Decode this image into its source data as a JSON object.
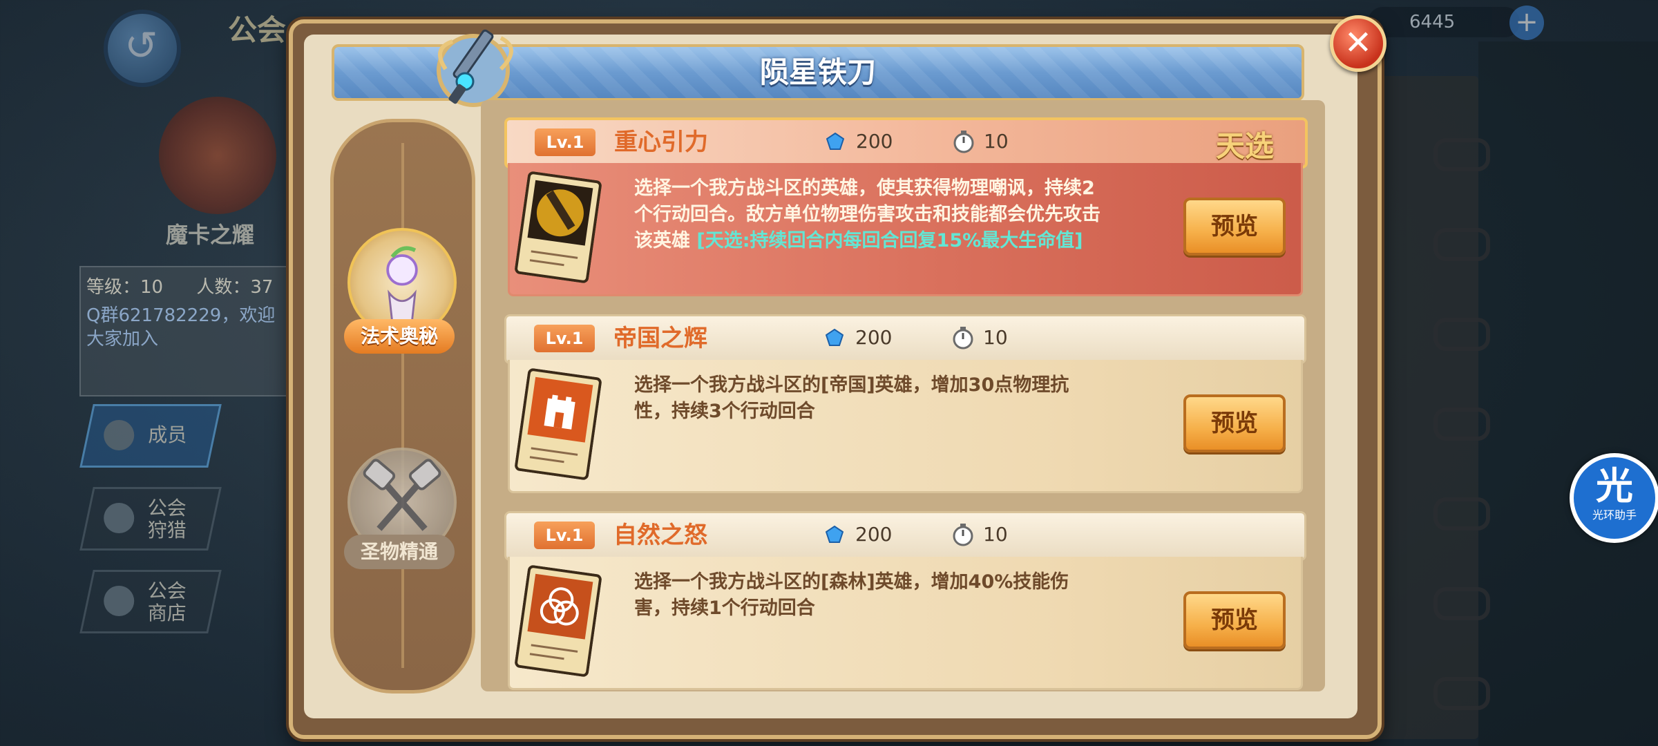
{
  "background": {
    "header_title": "公会",
    "guild_name": "魔卡之耀",
    "level_label": "等级：10",
    "members_label": "人数：37",
    "notice": "Q群621782229，欢迎大家加入",
    "currency_1": "6445",
    "nav": [
      {
        "label": "成员"
      },
      {
        "label": "公会\n狩猎"
      },
      {
        "label": "公会\n商店"
      }
    ]
  },
  "dialog": {
    "title": "陨星铁刀",
    "close_glyph": "✕",
    "tabs": [
      {
        "label": "法术奥秘",
        "active": true
      },
      {
        "label": "圣物精通",
        "active": false
      }
    ],
    "skills": [
      {
        "level": "Lv.1",
        "name": "重心引力",
        "gem_cost": "200",
        "timer": "10",
        "featured": true,
        "chosen_label": "天选",
        "description": "选择一个我方战斗区的英雄，使其获得物理嘲讽，持续2个行动回合。敌方单位物理伤害攻击和技能都会优先攻击该英雄",
        "bonus": "[天选:持续回合内每回合回复15%最大生命值]",
        "preview_label": "预览",
        "icon": "sword-card-icon"
      },
      {
        "level": "Lv.1",
        "name": "帝国之辉",
        "gem_cost": "200",
        "timer": "10",
        "featured": false,
        "description": "选择一个我方战斗区的[帝国]英雄，增加30点物理抗性，持续3个行动回合",
        "preview_label": "预览",
        "icon": "castle-card-icon"
      },
      {
        "level": "Lv.1",
        "name": "自然之怒",
        "gem_cost": "200",
        "timer": "10",
        "featured": false,
        "description": "选择一个我方战斗区的[森林]英雄，增加40%技能伤害，持续1个行动回合",
        "preview_label": "预览",
        "icon": "triquetra-card-icon"
      }
    ]
  },
  "helper": {
    "glyph": "光",
    "label": "光环助手"
  },
  "colors": {
    "accent_orange": "#e06a2a",
    "title_blue": "#6b9bd0",
    "bonus_teal": "#63e6d4",
    "button_gold": "#f6b04a"
  }
}
